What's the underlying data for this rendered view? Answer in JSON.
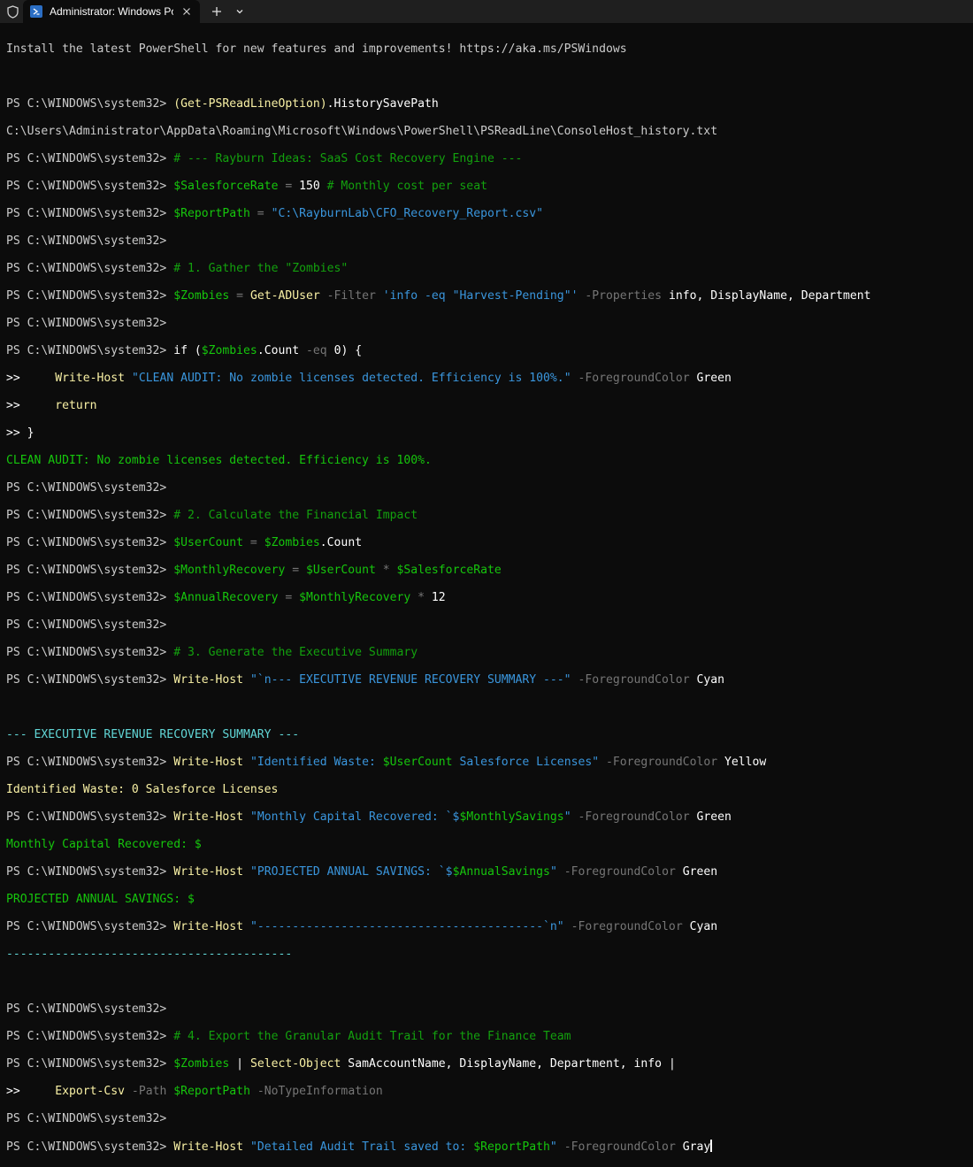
{
  "window": {
    "tab_title": "Administrator: Windows PowerShell",
    "new_tab_symbol": "+",
    "dropdown_symbol": "⌄",
    "close_symbol": "✕"
  },
  "console": {
    "prompt": "PS C:\\WINDOWS\\system32> ",
    "cont": ">> ",
    "banner": "Install the latest PowerShell for new features and improvements! https://aka.ms/PSWindows",
    "l1_a": "(Get-PSReadLineOption)",
    "l1_b": ".HistorySavePath",
    "l2": "C:\\Users\\Administrator\\AppData\\Roaming\\Microsoft\\Windows\\PowerShell\\PSReadLine\\ConsoleHost_history.txt",
    "l3": "# --- Rayburn Ideas: SaaS Cost Recovery Engine ---",
    "l4_var": "$SalesforceRate",
    "l4_op": " = ",
    "l4_num": "150",
    "l4_cm": " # Monthly cost per seat",
    "l5_var": "$ReportPath",
    "l5_op": " = ",
    "l5_str": "\"C:\\RayburnLab\\CFO_Recovery_Report.csv\"",
    "l7": "# 1. Gather the \"Zombies\"",
    "l8_var": "$Zombies",
    "l8_op": " = ",
    "l8_cmd": "Get-ADUser",
    "l8_p1": " -Filter ",
    "l8_str": "'info -eq \"Harvest-Pending\"'",
    "l8_p2": " -Properties ",
    "l8_args": "info, DisplayName, Department",
    "l10_kw": "if (",
    "l10_var": "$Zombies",
    "l10_mem": ".Count",
    "l10_p": " -eq ",
    "l10_end": "0) {",
    "l11_cmd": "Write-Host",
    "l11_str": "\"CLEAN AUDIT: No zombie licenses detected. Efficiency is 100%.\"",
    "l11_p": " -ForegroundColor ",
    "l11_c": "Green",
    "l12": "return",
    "l13": "}",
    "l14": "CLEAN AUDIT: No zombie licenses detected. Efficiency is 100%.",
    "l16": "# 2. Calculate the Financial Impact",
    "l17_var": "$UserCount",
    "l17_op": " = ",
    "l17_var2": "$Zombies",
    "l17_mem": ".Count",
    "l18_var": "$MonthlyRecovery",
    "l18_op": " = ",
    "l18_var2": "$UserCount",
    "l18_op2": " * ",
    "l18_var3": "$SalesforceRate",
    "l19_var": "$AnnualRecovery",
    "l19_op": " = ",
    "l19_var2": "$MonthlyRecovery",
    "l19_op2": " * ",
    "l19_num": "12",
    "l21": "# 3. Generate the Executive Summary",
    "l22_cmd": "Write-Host",
    "l22_str": "\"`n--- EXECUTIVE REVENUE RECOVERY SUMMARY ---\"",
    "l22_p": " -ForegroundColor ",
    "l22_c": "Cyan",
    "l24": "--- EXECUTIVE REVENUE RECOVERY SUMMARY ---",
    "l25_cmd": "Write-Host",
    "l25_s1": "\"Identified Waste: ",
    "l25_var": "$UserCount",
    "l25_s2": " Salesforce Licenses\"",
    "l25_p": " -ForegroundColor ",
    "l25_c": "Yellow",
    "l26": "Identified Waste: 0 Salesforce Licenses",
    "l27_cmd": "Write-Host",
    "l27_s1": "\"Monthly Capital Recovered: `$",
    "l27_var": "$MonthlySavings",
    "l27_s2": "\"",
    "l27_p": " -ForegroundColor ",
    "l27_c": "Green",
    "l28": "Monthly Capital Recovered: $",
    "l29_cmd": "Write-Host",
    "l29_s1": "\"PROJECTED ANNUAL SAVINGS: `$",
    "l29_var": "$AnnualSavings",
    "l29_s2": "\"",
    "l29_p": " -ForegroundColor ",
    "l29_c": "Green",
    "l30": "PROJECTED ANNUAL SAVINGS: $",
    "l31_cmd": "Write-Host",
    "l31_str": "\"-----------------------------------------`n\"",
    "l31_p": " -ForegroundColor ",
    "l31_c": "Cyan",
    "l32": "-----------------------------------------",
    "l35": "# 4. Export the Granular Audit Trail for the Finance Team",
    "l36_var": "$Zombies",
    "l36_pipe": " | ",
    "l36_cmd": "Select-Object",
    "l36_args": " SamAccountName, DisplayName, Department, info ",
    "l36_pipe2": "|",
    "l37_cmd": "Export-Csv",
    "l37_p1": " -Path ",
    "l37_var": "$ReportPath",
    "l37_p2": " -NoTypeInformation",
    "l39_cmd": "Write-Host",
    "l39_s1": "\"Detailed Audit Trail saved to: ",
    "l39_var": "$ReportPath",
    "l39_s2": "\"",
    "l39_p": " -ForegroundColor ",
    "l39_c": "Gray"
  }
}
